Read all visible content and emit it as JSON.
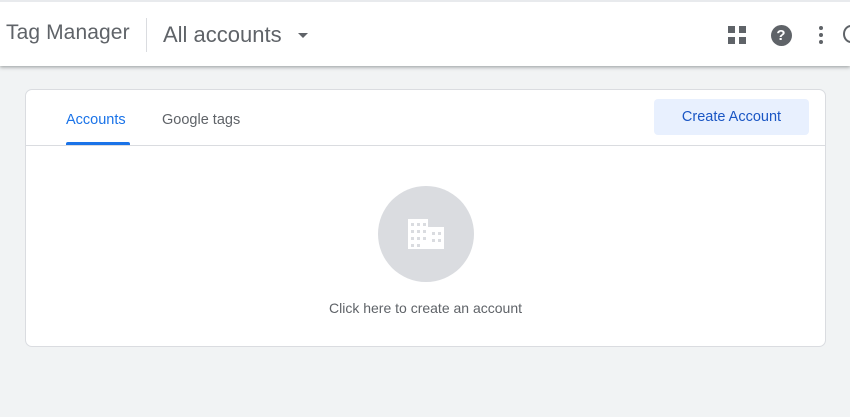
{
  "header": {
    "app_title": "Tag Manager",
    "account_selector": "All accounts",
    "icons": [
      "apps-icon",
      "help-icon",
      "more-vert-icon",
      "account-avatar-icon"
    ],
    "help_glyph": "?"
  },
  "card": {
    "tabs": [
      {
        "label": "Accounts",
        "active": true
      },
      {
        "label": "Google tags",
        "active": false
      }
    ],
    "create_button": "Create Account",
    "empty_state": {
      "icon": "building-icon",
      "text": "Click here to create an account"
    }
  },
  "colors": {
    "accent": "#1a73e8",
    "button_bg": "#e8f0fe",
    "page_bg": "#f1f3f4",
    "icon_gray": "#5f6368",
    "empty_circle": "#dadce0"
  }
}
